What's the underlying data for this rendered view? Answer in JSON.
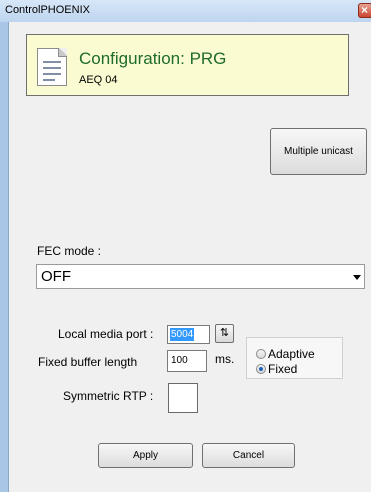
{
  "window": {
    "title": "ControlPHOENIX"
  },
  "header": {
    "title": "Configuration: PRG",
    "subtitle": "AEQ 04"
  },
  "buttons": {
    "multiple_unicast": "Multiple unicast",
    "apply": "Apply",
    "cancel": "Cancel"
  },
  "fec": {
    "label": "FEC mode :",
    "selected": "OFF"
  },
  "media": {
    "local_port_label": "Local media port :",
    "local_port_value": "5004",
    "buffer_label": "Fixed buffer length",
    "buffer_value": "100",
    "buffer_unit": "ms.",
    "symmetric_rtp_label": "Symmetric RTP :"
  },
  "buffer_mode": {
    "options": [
      "Adaptive",
      "Fixed"
    ],
    "selected": "Fixed"
  },
  "icons": {
    "close": "close-icon",
    "document": "document-icon",
    "spin": "spin-icon",
    "dropdown": "chevron-down-icon"
  }
}
